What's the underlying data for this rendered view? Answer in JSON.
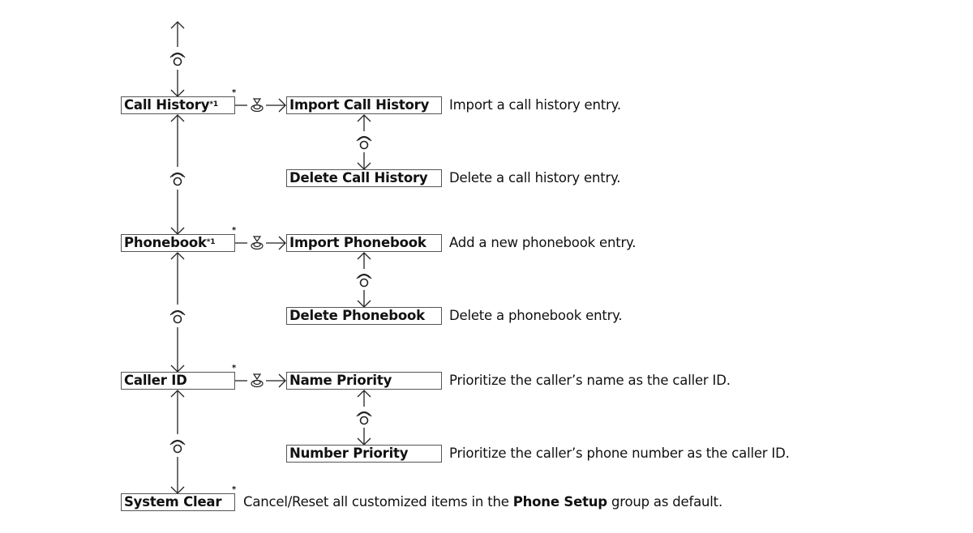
{
  "diagram": {
    "main_items": [
      {
        "label": "Call History",
        "note": "*1",
        "marker": "*"
      },
      {
        "label": "Phonebook",
        "note": "*1",
        "marker": "*"
      },
      {
        "label": "Caller ID",
        "note": "",
        "marker": "*"
      },
      {
        "label": "System Clear",
        "note": "",
        "marker": "*"
      }
    ],
    "sub_items": [
      {
        "label": "Import Call History",
        "description": "Import a call history entry."
      },
      {
        "label": "Delete Call History",
        "description": "Delete a call history entry."
      },
      {
        "label": "Import Phonebook",
        "description": "Add a new phonebook entry."
      },
      {
        "label": "Delete Phonebook",
        "description": "Delete a phonebook entry."
      },
      {
        "label": "Name Priority",
        "description": "Prioritize the caller’s name as the caller ID."
      },
      {
        "label": "Number Priority",
        "description": "Prioritize the caller’s phone number as the caller ID."
      }
    ],
    "system_clear_description": {
      "before": "Cancel/Reset all customized items in the ",
      "bold": "Phone Setup",
      "after": " group as default."
    },
    "icons": {
      "rotate": "rotate-dial-icon",
      "press": "press-dial-icon"
    }
  }
}
